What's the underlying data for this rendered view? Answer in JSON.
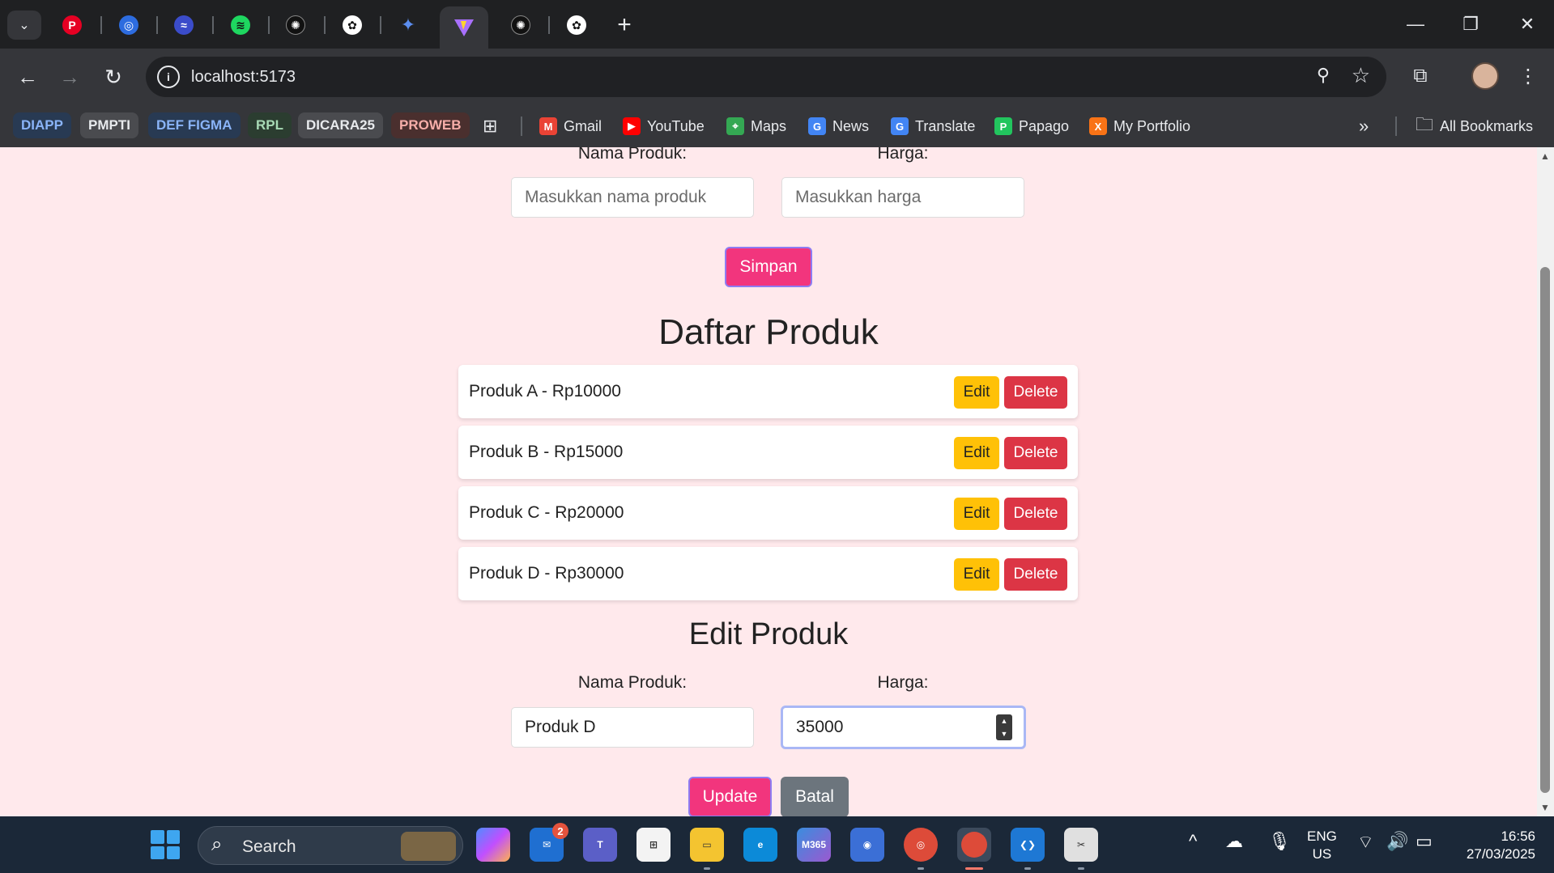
{
  "browser": {
    "url": "localhost:5173",
    "bookmark_chips": [
      {
        "label": "DIAPP",
        "color": "#8ab4f8",
        "bg": "#283a53"
      },
      {
        "label": "PMPTI",
        "color": "#e8eaed",
        "bg": "#4a4b4f"
      },
      {
        "label": "DEF FIGMA",
        "color": "#8ab4f8",
        "bg": "#283a53"
      },
      {
        "label": "RPL",
        "color": "#a8dab5",
        "bg": "#2b3d30"
      },
      {
        "label": "DICARA25",
        "color": "#e8eaed",
        "bg": "#4a4b4f"
      },
      {
        "label": "PROWEB",
        "color": "#f6aea9",
        "bg": "#4a2f2e"
      }
    ],
    "bookmarks": [
      {
        "label": "Gmail",
        "icon": "gmail-icon",
        "color": "#ea4335",
        "glyph": "M"
      },
      {
        "label": "YouTube",
        "icon": "youtube-icon",
        "color": "#ff0000",
        "glyph": "▶"
      },
      {
        "label": "Maps",
        "icon": "maps-icon",
        "color": "#34a853",
        "glyph": "⌖"
      },
      {
        "label": "News",
        "icon": "news-icon",
        "color": "#4285f4",
        "glyph": "G"
      },
      {
        "label": "Translate",
        "icon": "translate-icon",
        "color": "#4285f4",
        "glyph": "G"
      },
      {
        "label": "Papago",
        "icon": "papago-icon",
        "color": "#22c55e",
        "glyph": "P"
      },
      {
        "label": "My Portfolio",
        "icon": "portfolio-icon",
        "color": "#f97316",
        "glyph": "X"
      }
    ],
    "all_bookmarks": "All Bookmarks"
  },
  "page": {
    "add_form": {
      "name_label": "Nama Produk:",
      "name_placeholder": "Masukkan nama produk",
      "price_label": "Harga:",
      "price_placeholder": "Masukkan harga",
      "save_label": "Simpan"
    },
    "list_title": "Daftar Produk",
    "products": [
      {
        "text": "Produk A - Rp10000",
        "edit": "Edit",
        "delete": "Delete"
      },
      {
        "text": "Produk B - Rp15000",
        "edit": "Edit",
        "delete": "Delete"
      },
      {
        "text": "Produk C - Rp20000",
        "edit": "Edit",
        "delete": "Delete"
      },
      {
        "text": "Produk D - Rp30000",
        "edit": "Edit",
        "delete": "Delete"
      }
    ],
    "edit_form": {
      "title": "Edit Produk",
      "name_label": "Nama Produk:",
      "name_value": "Produk D",
      "price_label": "Harga:",
      "price_value": "35000",
      "update_label": "Update",
      "cancel_label": "Batal"
    }
  },
  "taskbar": {
    "search_label": "Search",
    "mail_badge": "2",
    "language_top": "ENG",
    "language_bottom": "US",
    "time": "16:56",
    "date": "27/03/2025"
  },
  "colors": {
    "page_bg": "#ffe9ec",
    "primary_pink": "#f2357d",
    "edit_yellow": "#ffc107",
    "delete_red": "#dc3545",
    "cancel_grey": "#6c757d"
  }
}
